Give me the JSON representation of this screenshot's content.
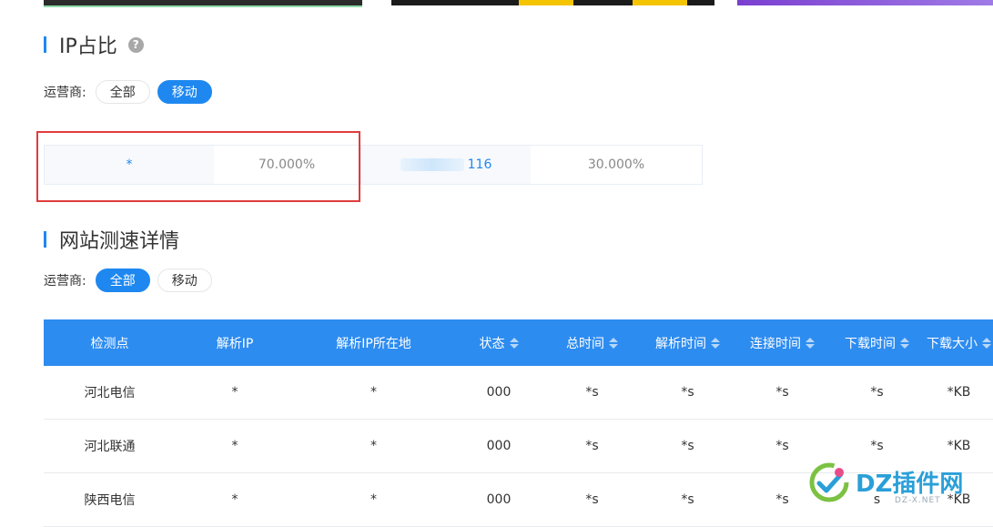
{
  "ip_section": {
    "title": "IP占比",
    "help_icon": "question-circle-icon",
    "carrier_label": "运营商:",
    "filters": [
      {
        "label": "全部",
        "active": false
      },
      {
        "label": "移动",
        "active": true
      }
    ],
    "items": [
      {
        "address": "*",
        "percent": "70.000%"
      },
      {
        "address_suffix": "116",
        "percent": "30.000%"
      }
    ]
  },
  "speed_section": {
    "title": "网站测速详情",
    "carrier_label": "运营商:",
    "filters": [
      {
        "label": "全部",
        "active": true
      },
      {
        "label": "移动",
        "active": false
      }
    ],
    "columns": [
      "检测点",
      "解析IP",
      "解析IP所在地",
      "状态",
      "总时间",
      "解析时间",
      "连接时间",
      "下载时间",
      "下载大小"
    ],
    "rows": [
      {
        "node": "河北电信",
        "ip": "*",
        "location": "*",
        "status": "000",
        "total": "*s",
        "dns": "*s",
        "connect": "*s",
        "download": "*s",
        "size": "*KB"
      },
      {
        "node": "河北联通",
        "ip": "*",
        "location": "*",
        "status": "000",
        "total": "*s",
        "dns": "*s",
        "connect": "*s",
        "download": "*s",
        "size": "*KB"
      },
      {
        "node": "陕西电信",
        "ip": "*",
        "location": "*",
        "status": "000",
        "total": "*s",
        "dns": "*s",
        "connect": "*s",
        "download": "s",
        "size": "*KB"
      }
    ]
  },
  "watermark": {
    "brand": "DZ插件网",
    "url": "DZ-X.NET"
  },
  "colors": {
    "accent": "#1e88f0",
    "table_header": "#2d8cf0",
    "highlight": "#e03c3c"
  }
}
